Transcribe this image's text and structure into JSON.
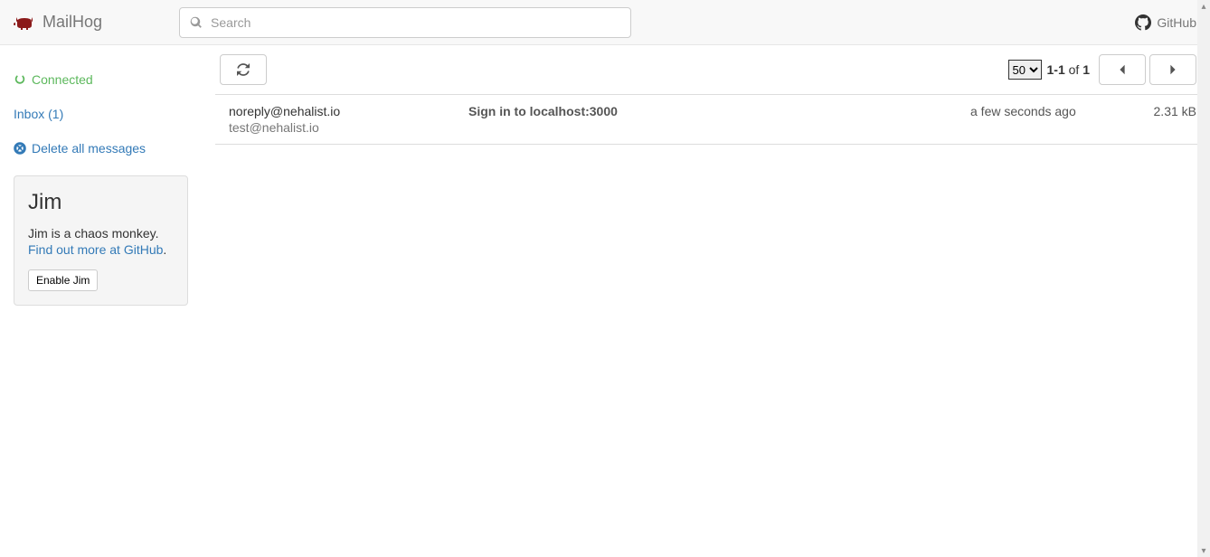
{
  "header": {
    "brand": "MailHog",
    "search_placeholder": "Search",
    "github_label": "GitHub"
  },
  "sidebar": {
    "connected_label": "Connected",
    "inbox_label": "Inbox (1)",
    "delete_label": "Delete all messages",
    "jim": {
      "title": "Jim",
      "desc": "Jim is a chaos monkey.",
      "link_text": "Find out more at GitHub",
      "link_suffix": ".",
      "button_label": "Enable Jim"
    }
  },
  "toolbar": {
    "page_size_options": [
      "50"
    ],
    "page_size_selected": "50",
    "range": "1-1",
    "of_word": "of",
    "total": "1"
  },
  "messages": [
    {
      "from": "noreply@nehalist.io",
      "to": "test@nehalist.io",
      "subject": "Sign in to localhost:3000",
      "time": "a few seconds ago",
      "size": "2.31 kB"
    }
  ]
}
